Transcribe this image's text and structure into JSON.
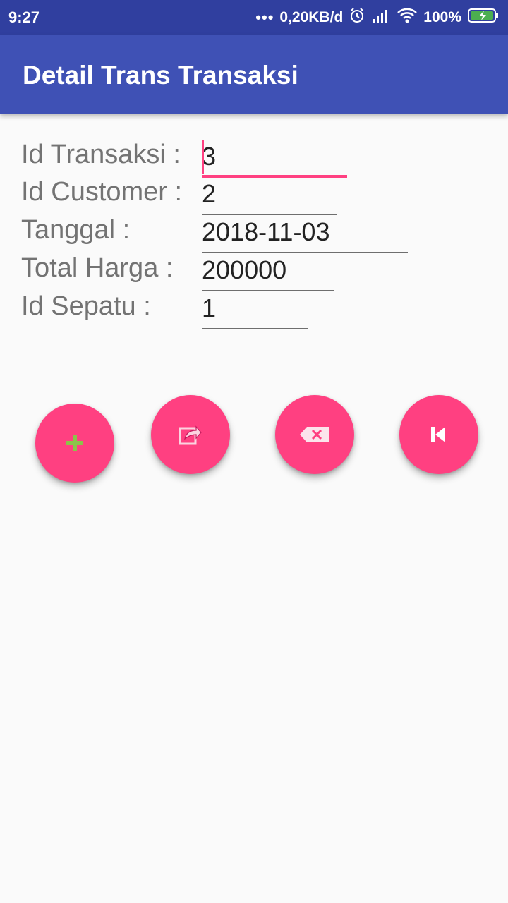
{
  "status_bar": {
    "time": "9:27",
    "dots": "•••",
    "network_speed": "0,20KB/d",
    "battery_percent": "100%",
    "icons": [
      "alarm-icon",
      "signal-icon",
      "wifi-icon",
      "battery-charging-icon"
    ]
  },
  "app_bar": {
    "title": "Detail Trans Transaksi"
  },
  "form": {
    "fields": [
      {
        "label": "Id Transaksi :",
        "value": "3"
      },
      {
        "label": "Id Customer :",
        "value": "2"
      },
      {
        "label": "Tanggal :",
        "value": "2018-11-03"
      },
      {
        "label": "Total Harga :",
        "value": "200000"
      },
      {
        "label": "Id Sepatu :",
        "value": "1"
      }
    ]
  },
  "actions": {
    "buttons": [
      {
        "icon": "add-icon"
      },
      {
        "icon": "edit-icon"
      },
      {
        "icon": "backspace-delete-icon"
      },
      {
        "icon": "skip-previous-icon"
      }
    ]
  },
  "colors": {
    "status_bar": "#303f9f",
    "app_bar": "#3f51b5",
    "accent": "#ff4081",
    "background": "#fafafa",
    "add_icon": "#8bc34a"
  }
}
